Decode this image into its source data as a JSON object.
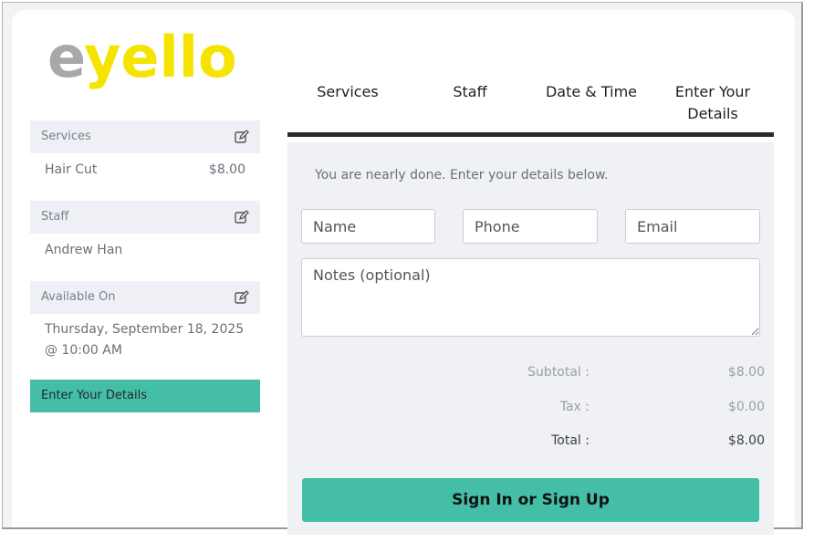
{
  "logo": {
    "text": "eyello",
    "colors": {
      "e": "#a8a8a8",
      "rest": "#f5e400"
    }
  },
  "sidebar": {
    "sections": [
      {
        "heading": "Services",
        "value": "Hair Cut",
        "price": "$8.00"
      },
      {
        "heading": "Staff",
        "value": "Andrew Han"
      },
      {
        "heading": "Available On",
        "value_line1": "Thursday, September 18, 2025",
        "value_line2": "@ 10:00 AM"
      }
    ],
    "active_step": "Enter Your Details"
  },
  "tabs": [
    {
      "label": "Services"
    },
    {
      "label": "Staff"
    },
    {
      "label": "Date & Time"
    },
    {
      "label_line1": "Enter Your",
      "label_line2": "Details"
    }
  ],
  "form": {
    "intro": "You are nearly done. Enter your details below.",
    "name_placeholder": "Name",
    "phone_placeholder": "Phone",
    "email_placeholder": "Email",
    "notes_placeholder": "Notes (optional)"
  },
  "summary": {
    "subtotal_label": "Subtotal :",
    "subtotal_value": "$8.00",
    "tax_label": "Tax :",
    "tax_value": "$0.00",
    "total_label": "Total :",
    "total_value": "$8.00"
  },
  "cta_label": "Sign In or Sign Up",
  "accent_color": "#45bea7"
}
